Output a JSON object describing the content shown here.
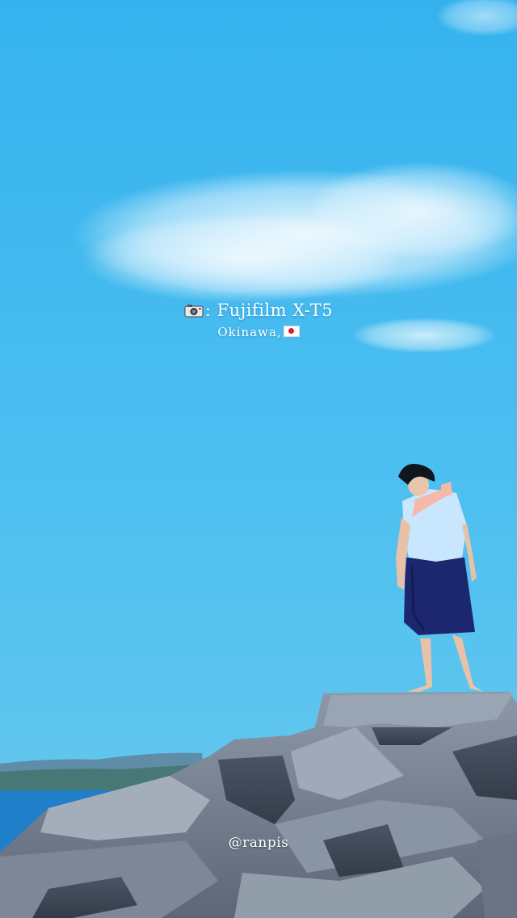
{
  "caption": {
    "camera_icon": "camera-emoji",
    "camera_model": ": Fujifilm X-T5",
    "location": "Okinawa,",
    "flag_icon": "japan-flag-emoji"
  },
  "watermark": {
    "handle": "@ranpis"
  },
  "colors": {
    "sky": "#39b4ee",
    "sea": "#1f7fc8",
    "skirt": "#1d2770",
    "blouse": "#c9e6ff"
  }
}
